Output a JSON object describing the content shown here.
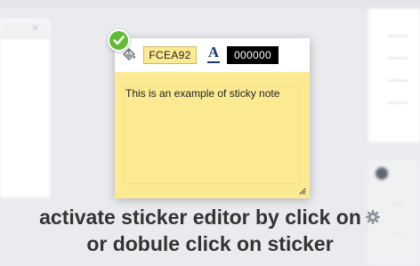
{
  "editor": {
    "background_color_value": "FCEA92",
    "text_color_value": "000000",
    "text_color_glyph": "A",
    "note_text": "This is an example of sticky note",
    "icons": {
      "fill": "paint-bucket-icon",
      "text_color": "text-color-icon",
      "confirm": "checkmark-icon",
      "resize": "resize-grip-icon"
    },
    "colors": {
      "note_background": "#FCEA92",
      "confirm_badge": "#5FBA36",
      "text_color_swatch": "#000000"
    }
  },
  "caption": {
    "line1": "activate sticker editor by click on",
    "line2": "or dobule click on sticker",
    "icon": "gear-icon"
  },
  "background": {
    "left_panel_close_glyph": "×"
  }
}
